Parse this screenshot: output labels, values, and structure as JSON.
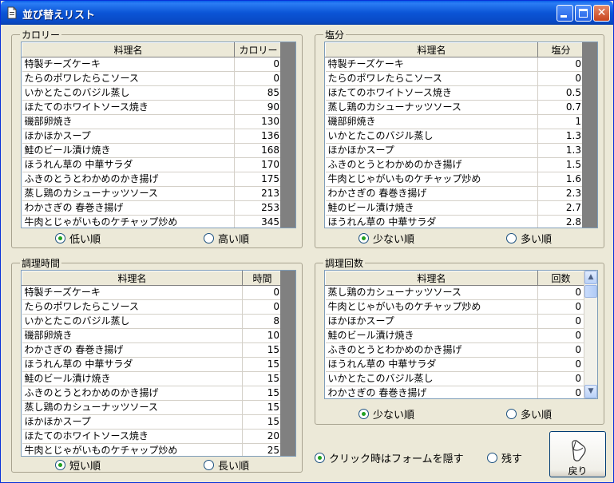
{
  "window": {
    "title": "並び替えリスト",
    "icon": "document-icon"
  },
  "calorie": {
    "group_label": "カロリー",
    "col_name": "料理名",
    "col_value": "カロリー",
    "rows": [
      [
        "特製チーズケーキ",
        "0"
      ],
      [
        "たらのポワレたらこソース",
        "0"
      ],
      [
        "いかとたこのバジル蒸し",
        "85"
      ],
      [
        "ほたてのホワイトソース焼き",
        "90"
      ],
      [
        "磯部卵焼き",
        "130"
      ],
      [
        "ほかほかスープ",
        "136"
      ],
      [
        "鮭のビール漬け焼き",
        "168"
      ],
      [
        "ほうれん草の 中華サラダ",
        "170"
      ],
      [
        "ふきのとうとわかめのかき揚げ",
        "175"
      ],
      [
        "蒸し鶏のカシューナッツソース",
        "213"
      ],
      [
        "わかさぎの 春巻き揚げ",
        "253"
      ],
      [
        "牛肉とじゃがいものケチャップ炒め",
        "345"
      ]
    ],
    "opt_asc": "低い順",
    "opt_desc": "高い順",
    "selected": "asc"
  },
  "salt": {
    "group_label": "塩分",
    "col_name": "料理名",
    "col_value": "塩分",
    "rows": [
      [
        "特製チーズケーキ",
        "0"
      ],
      [
        "たらのポワレたらこソース",
        "0"
      ],
      [
        "ほたてのホワイトソース焼き",
        "0.5"
      ],
      [
        "蒸し鶏のカシューナッツソース",
        "0.7"
      ],
      [
        "磯部卵焼き",
        "1"
      ],
      [
        "いかとたこのバジル蒸し",
        "1.3"
      ],
      [
        "ほかほかスープ",
        "1.3"
      ],
      [
        "ふきのとうとわかめのかき揚げ",
        "1.5"
      ],
      [
        "牛肉とじゃがいものケチャップ炒め",
        "1.6"
      ],
      [
        "わかさぎの 春巻き揚げ",
        "2.3"
      ],
      [
        "鮭のビール漬け焼き",
        "2.7"
      ],
      [
        "ほうれん草の 中華サラダ",
        "2.8"
      ]
    ],
    "opt_asc": "少ない順",
    "opt_desc": "多い順",
    "selected": "asc"
  },
  "time": {
    "group_label": "調理時間",
    "col_name": "料理名",
    "col_value": "時間",
    "rows": [
      [
        "特製チーズケーキ",
        "0"
      ],
      [
        "たらのポワレたらこソース",
        "0"
      ],
      [
        "いかとたこのバジル蒸し",
        "8"
      ],
      [
        "磯部卵焼き",
        "10"
      ],
      [
        "わかさぎの 春巻き揚げ",
        "15"
      ],
      [
        "ほうれん草の 中華サラダ",
        "15"
      ],
      [
        "鮭のビール漬け焼き",
        "15"
      ],
      [
        "ふきのとうとわかめのかき揚げ",
        "15"
      ],
      [
        "蒸し鶏のカシューナッツソース",
        "15"
      ],
      [
        "ほかほかスープ",
        "15"
      ],
      [
        "ほたてのホワイトソース焼き",
        "20"
      ],
      [
        "牛肉とじゃがいものケチャップ炒め",
        "25"
      ]
    ],
    "opt_asc": "短い順",
    "opt_desc": "長い順",
    "selected": "asc"
  },
  "count": {
    "group_label": "調理回数",
    "col_name": "料理名",
    "col_value": "回数",
    "rows": [
      [
        "蒸し鶏のカシューナッツソース",
        "0"
      ],
      [
        "牛肉とじゃがいものケチャップ炒め",
        "0"
      ],
      [
        "ほかほかスープ",
        "0"
      ],
      [
        "鮭のビール漬け焼き",
        "0"
      ],
      [
        "ふきのとうとわかめのかき揚げ",
        "0"
      ],
      [
        "ほうれん草の 中華サラダ",
        "0"
      ],
      [
        "いかとたこのバジル蒸し",
        "0"
      ],
      [
        "わかさぎの 春巻き揚げ",
        "0"
      ]
    ],
    "opt_asc": "少ない順",
    "opt_desc": "多い順",
    "selected": "asc"
  },
  "footer": {
    "opt_hide": "クリック時はフォームを隠す",
    "opt_keep": "残す",
    "selected": "hide",
    "back_label": "戻り",
    "back_icon": "mouse-icon"
  },
  "colors": {
    "titlebar": "#0a5ee8",
    "face": "#ece9d8",
    "radio_dot": "#21a121"
  }
}
